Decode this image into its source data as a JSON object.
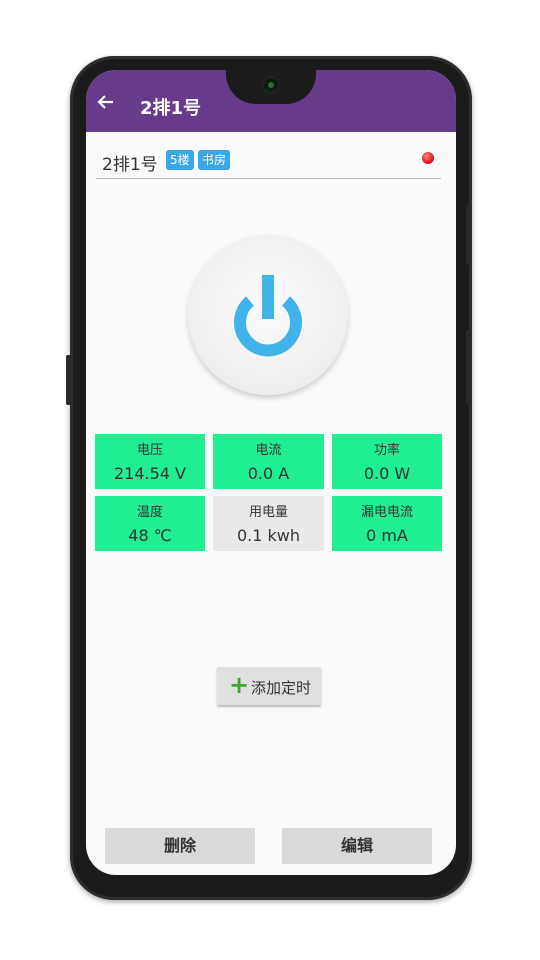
{
  "app_bar": {
    "back_icon": "arrow-left-icon",
    "title": "2排1号"
  },
  "device": {
    "name": "2排1号",
    "tags": [
      "5楼",
      "书房"
    ],
    "status_led": "red",
    "power_icon": "power-icon",
    "power_color": "#3fb3ea"
  },
  "metrics": [
    {
      "label": "电压",
      "value": "214.54 V",
      "style": "green"
    },
    {
      "label": "电流",
      "value": "0.0 A",
      "style": "green"
    },
    {
      "label": "功率",
      "value": "0.0 W",
      "style": "green"
    },
    {
      "label": "温度",
      "value": "48 ℃",
      "style": "green"
    },
    {
      "label": "用电量",
      "value": "0.1 kwh",
      "style": "gray"
    },
    {
      "label": "漏电电流",
      "value": "0 mA",
      "style": "green"
    }
  ],
  "timer": {
    "icon": "plus-icon",
    "label": "添加定时"
  },
  "actions": {
    "delete_label": "删除",
    "edit_label": "编辑"
  },
  "colors": {
    "app_bar": "#673b8c",
    "tag": "#39a7e6",
    "metric_green": "#1fef92",
    "metric_gray": "#e9e9e9",
    "led": "#e01818"
  }
}
